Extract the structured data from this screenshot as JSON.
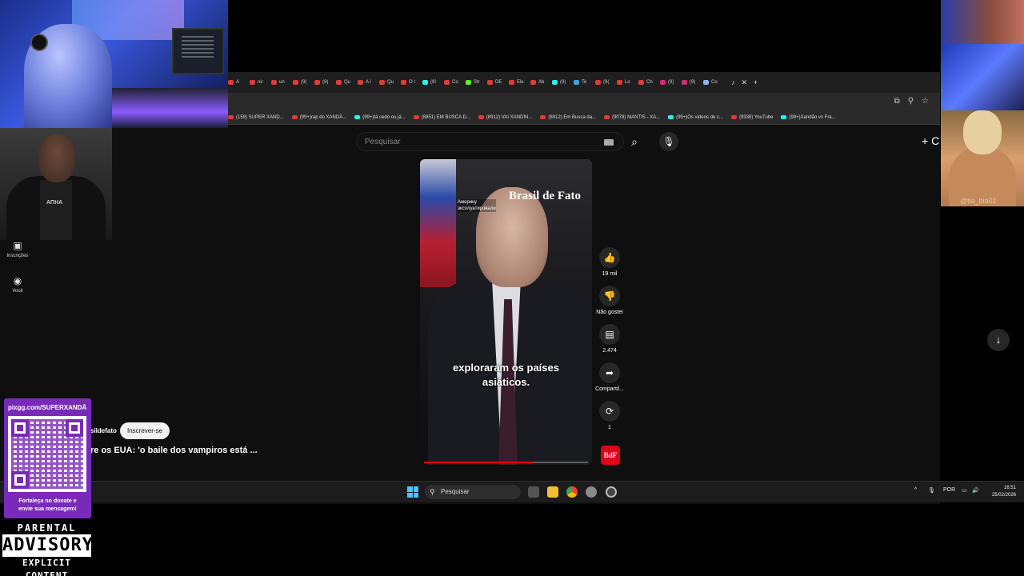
{
  "browser": {
    "tabs": [
      {
        "label": "A",
        "color": "#e53935"
      },
      {
        "label": "nir",
        "color": "#e53935"
      },
      {
        "label": "un",
        "color": "#e53935"
      },
      {
        "label": "(9(",
        "color": "#e53935"
      },
      {
        "label": "(8)",
        "color": "#e53935"
      },
      {
        "label": "Qu",
        "color": "#e53935"
      },
      {
        "label": "A i",
        "color": "#e53935"
      },
      {
        "label": "Qu",
        "color": "#e53935"
      },
      {
        "label": "O I",
        "color": "#e53935"
      },
      {
        "label": "(9!",
        "color": "#25f4ee"
      },
      {
        "label": "Co",
        "color": "#e53935"
      },
      {
        "label": "Str",
        "color": "#53fc18"
      },
      {
        "label": "DE",
        "color": "#e53935"
      },
      {
        "label": "Ele",
        "color": "#e53935"
      },
      {
        "label": "Ab",
        "color": "#e53935"
      },
      {
        "label": "(9)",
        "color": "#25f4ee"
      },
      {
        "label": "Te",
        "color": "#2aabee"
      },
      {
        "label": "(9(",
        "color": "#e53935"
      },
      {
        "label": "Lo",
        "color": "#e53935"
      },
      {
        "label": "Ch",
        "color": "#e53935"
      },
      {
        "label": "(9)",
        "color": "#d62976"
      },
      {
        "label": "(9)",
        "color": "#d62976"
      },
      {
        "label": "Co",
        "color": "#8ab4f8"
      }
    ],
    "bookmarks": [
      {
        "label": "(159) SUPER XAND...",
        "color": "#e53935"
      },
      {
        "label": "(99+)rap do XANDÃ...",
        "color": "#e53935"
      },
      {
        "label": "(99+)tá cedo ou já...",
        "color": "#25f4ee"
      },
      {
        "label": "(8851) EM BUSCA D...",
        "color": "#e53935"
      },
      {
        "label": "(8912) VAI XANDIN...",
        "color": "#e53935"
      },
      {
        "label": "(8912) Em Busca da...",
        "color": "#e53935"
      },
      {
        "label": "(9078) MANTIS - XA...",
        "color": "#e53935"
      },
      {
        "label": "(99+)Os videos de c...",
        "color": "#25f4ee"
      },
      {
        "label": "(9338) YouTube",
        "color": "#e53935"
      },
      {
        "label": "(99+)Xandão vs Fra...",
        "color": "#25f4ee"
      }
    ]
  },
  "youtube": {
    "search_placeholder": "Pesquisar",
    "create_label": "C",
    "nav": {
      "subscriptions": "Inscrições",
      "you": "Você"
    },
    "video": {
      "brand": "Brasil de Fato",
      "russian_caption_line1": "Америку",
      "russian_caption_line2": "эксплуатировали",
      "subtitle_line1": "exploraram os países",
      "subtitle_line2": "asiáticos.",
      "progress_fraction": 0.67
    },
    "actions": {
      "likes": "19 mil",
      "dislike": "Não gostei",
      "comments": "2.474",
      "share": "Compartil...",
      "remix": "1",
      "channel_badge": "BdF"
    },
    "channel_name": "sildefato",
    "subscribe_label": "Inscrever-se",
    "video_title": "re os EUA: 'o baile dos vampiros está ..."
  },
  "taskbar": {
    "search_placeholder": "Pesquisar",
    "language": "POR",
    "time": "16:51",
    "date": "25/02/2026"
  },
  "overlays": {
    "second_cam_logo": "AΠHA",
    "watermark": "@tia_bla01",
    "pix_url": "pixgg.com/SUPERXANDÃ",
    "pix_message_line1": "Fortaleça no donate e",
    "pix_message_line2": "envie sua mensagem!",
    "advisory_line1": "PARENTAL",
    "advisory_line2": "ADVISORY",
    "advisory_line3": "EXPLICIT CONTENT"
  }
}
